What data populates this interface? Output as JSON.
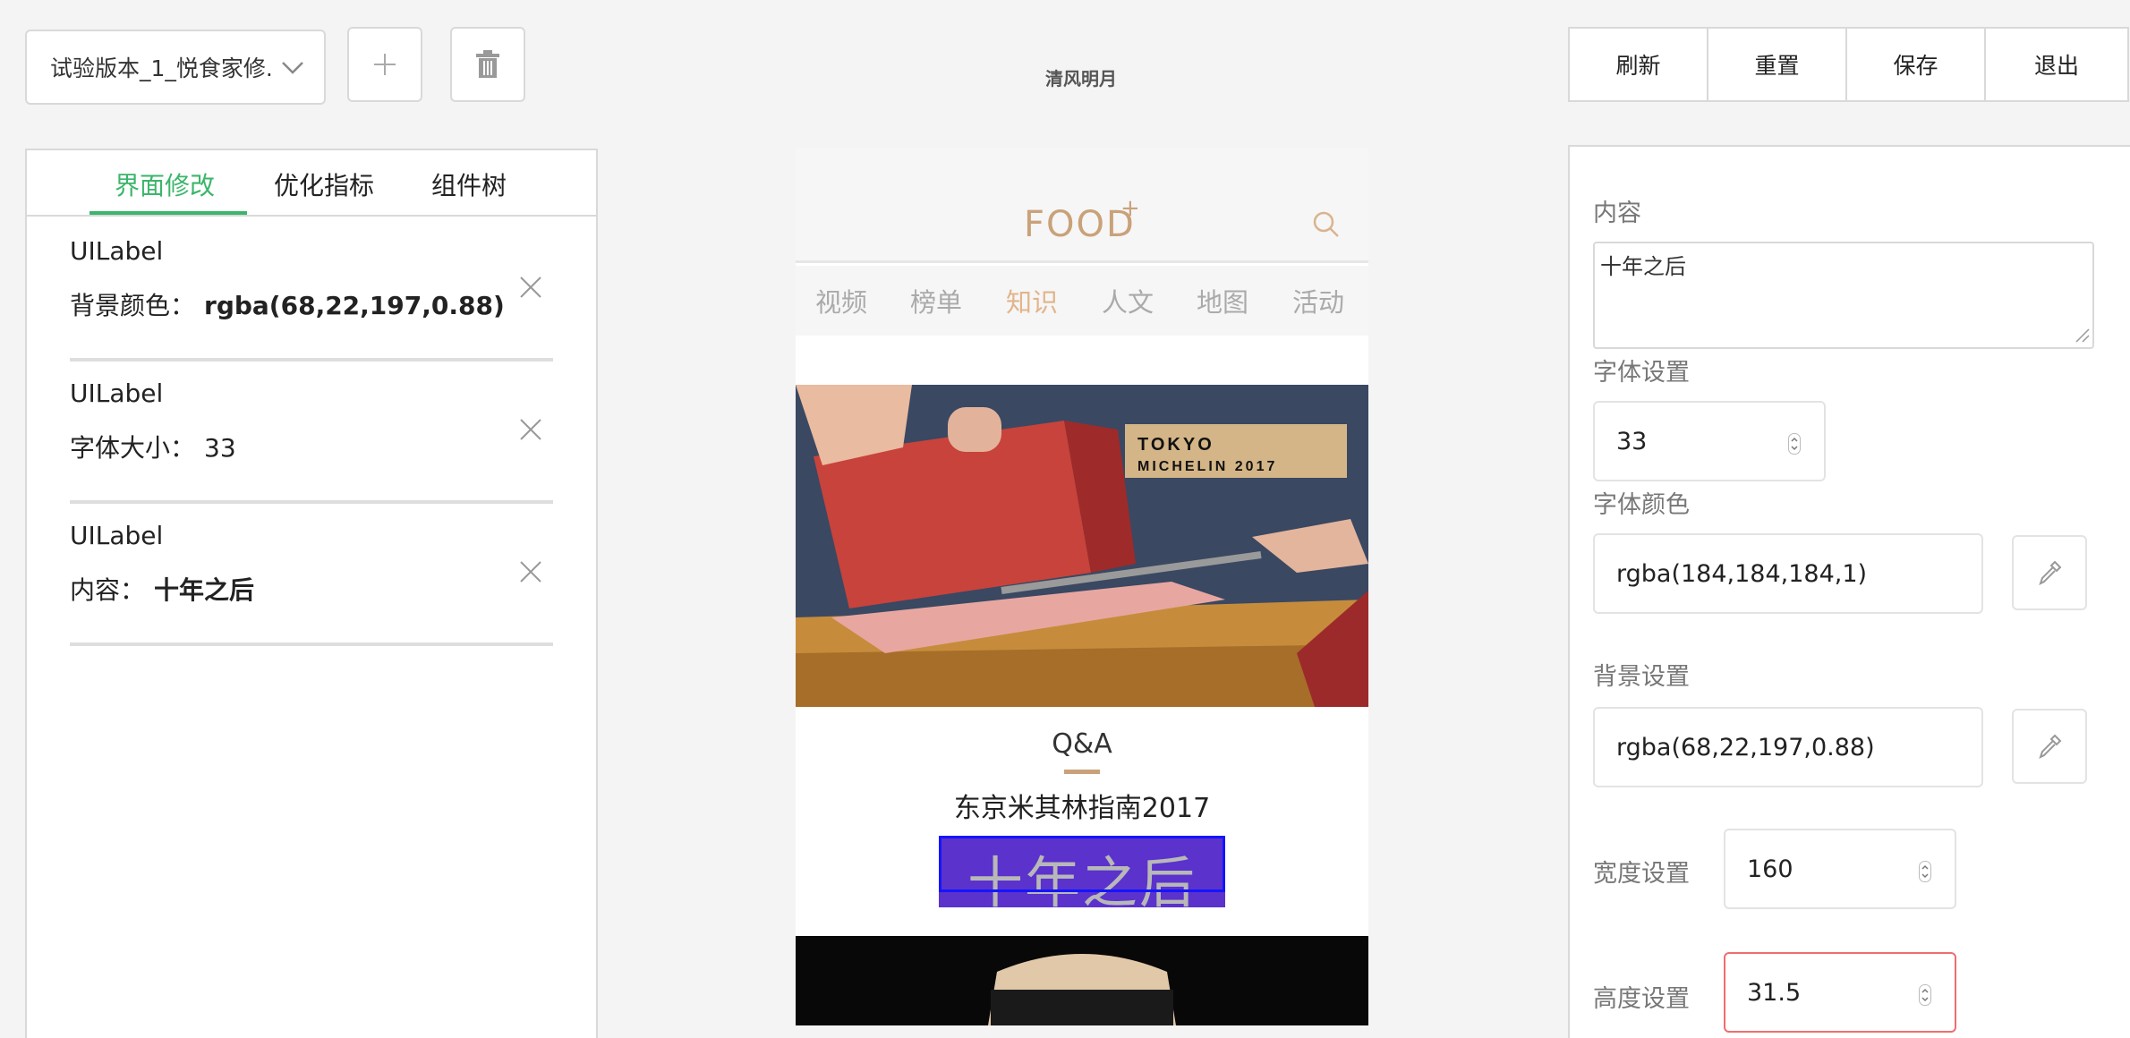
{
  "header": {
    "version_select": "试验版本_1_悦食家修...",
    "center_title": "清风明月",
    "toolbar": {
      "refresh": "刷新",
      "reset": "重置",
      "save": "保存",
      "exit": "退出"
    }
  },
  "left_panel": {
    "tabs": [
      {
        "label": "界面修改"
      },
      {
        "label": "优化指标"
      },
      {
        "label": "组件树"
      }
    ],
    "modifications": [
      {
        "type": "UILabel",
        "key": "背景颜色：",
        "value": "rgba(68,22,197,0.88)"
      },
      {
        "type": "UILabel",
        "key": "字体大小：",
        "value": "33"
      },
      {
        "type": "UILabel",
        "key": "内容：",
        "value": "十年之后"
      }
    ]
  },
  "preview": {
    "logo": "FOOD",
    "logo_plus": "+",
    "categories": [
      {
        "label": "视频"
      },
      {
        "label": "榜单"
      },
      {
        "label": "知识"
      },
      {
        "label": "人文"
      },
      {
        "label": "地图"
      },
      {
        "label": "活动"
      }
    ],
    "hero_badge_line1": "TOKYO",
    "hero_badge_line2": "MICHELIN 2017",
    "section": "Q&A",
    "article_title": "东京米其林指南2017",
    "selected_label_text": "十年之后"
  },
  "right_panel": {
    "content_label": "内容",
    "content_value": "十年之后",
    "font_label": "字体设置",
    "font_size": "33",
    "font_color_label": "字体颜色",
    "font_color": "rgba(184,184,184,1)",
    "bg_label": "背景设置",
    "bg_color": "rgba(68,22,197,0.88)",
    "width_label": "宽度设置",
    "width": "160",
    "height_label": "高度设置",
    "height": "31.5"
  },
  "colors": {
    "accent": "#3bb56a",
    "gold": "#c9a27a",
    "selection": "#1515ff",
    "error": "#f06d6d"
  }
}
